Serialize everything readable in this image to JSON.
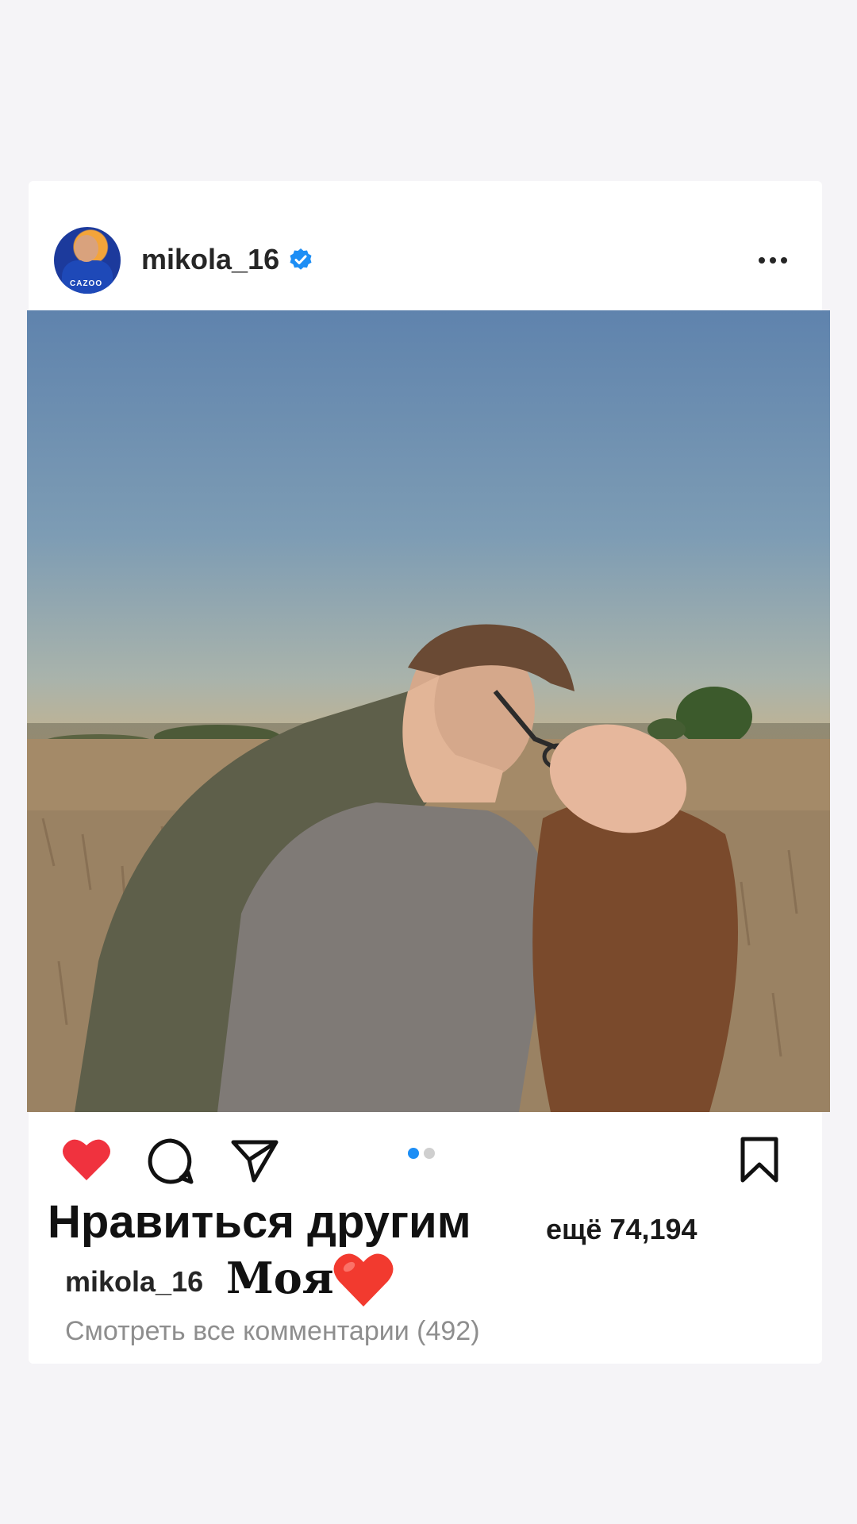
{
  "post": {
    "username": "mikola_16",
    "verified": true,
    "avatar_sponsor": "CAZOO",
    "likes_text": "Нравиться другим",
    "likes_more": "ещё 74,194",
    "caption_user": "mikola_16",
    "caption_text": "Моя",
    "caption_emoji": "red-heart",
    "comments_link": "Смотреть все комментарии (492)",
    "liked": true,
    "carousel": {
      "count": 2,
      "active": 1
    }
  },
  "colors": {
    "like_red": "#f0323e",
    "verified_blue": "#1d8ef5",
    "dot_active": "#1d8ef5"
  },
  "icons": [
    "heart-icon",
    "comment-icon",
    "share-icon",
    "bookmark-icon",
    "more-icon",
    "verified-badge-icon"
  ]
}
